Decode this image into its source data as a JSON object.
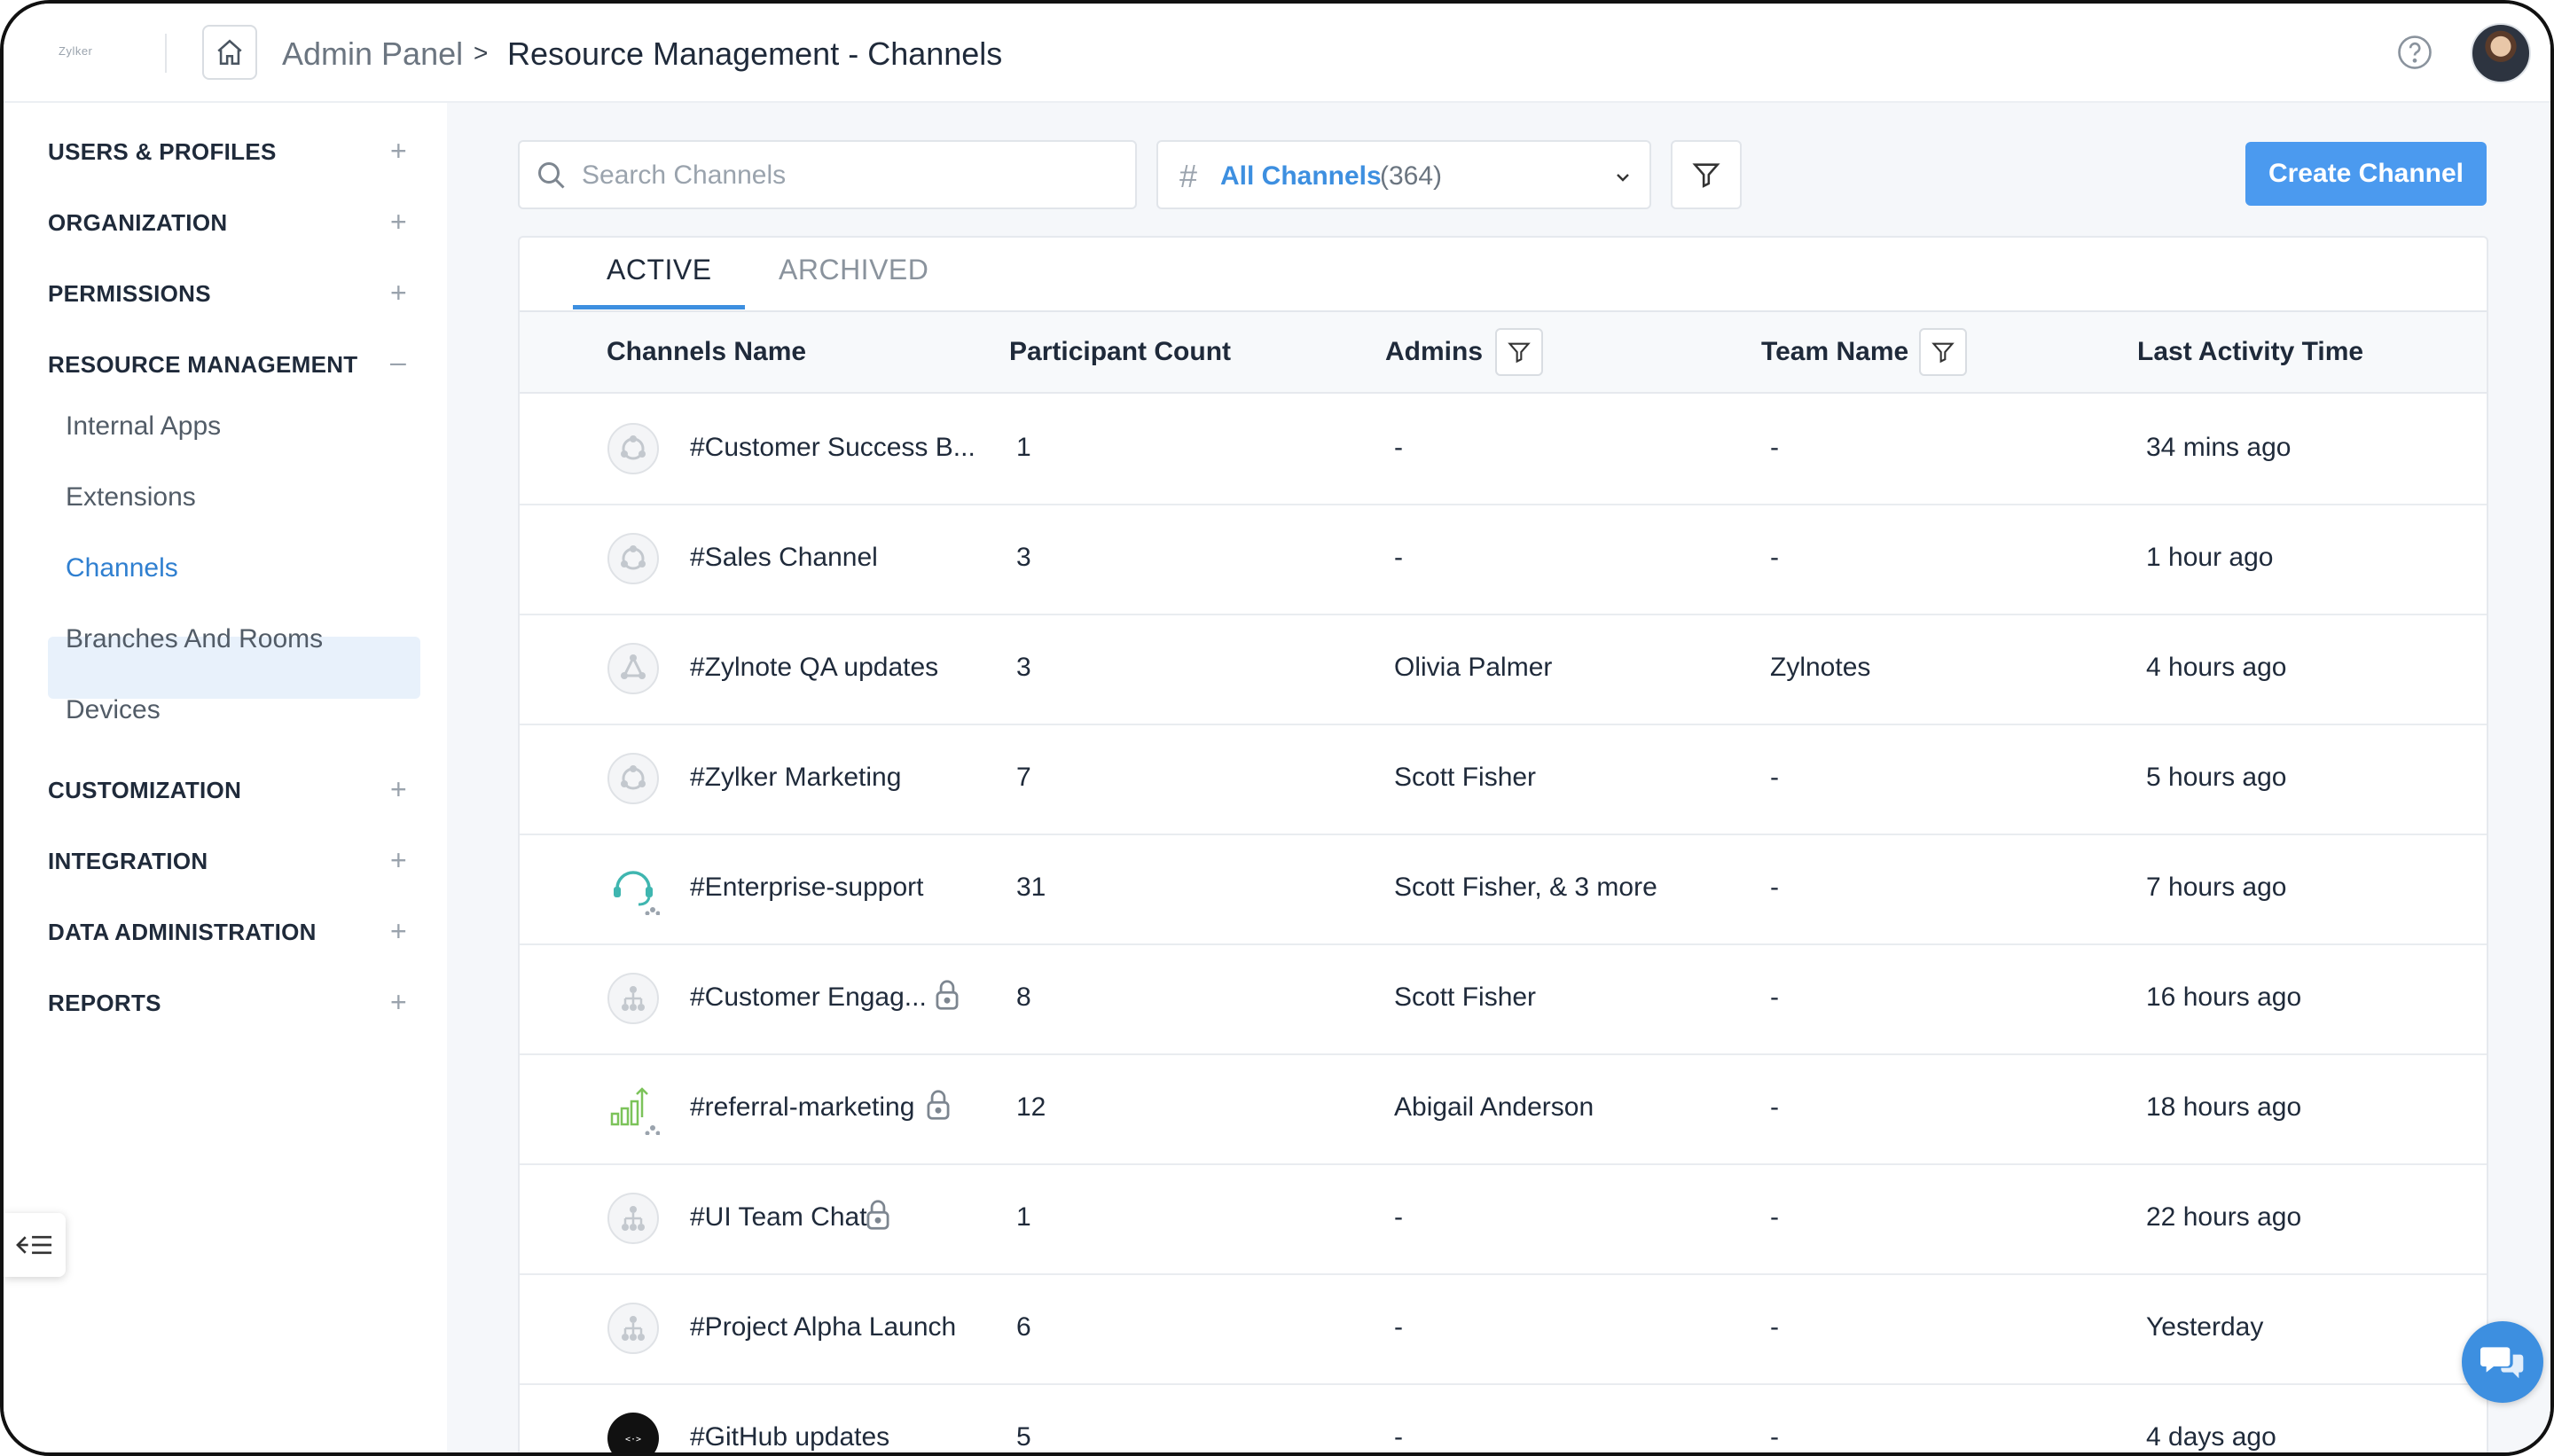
{
  "header": {
    "logo_text": "Zylker",
    "breadcrumb_root": "Admin Panel",
    "breadcrumb_separator": ">",
    "breadcrumb_current": "Resource Management - Channels"
  },
  "sidebar": {
    "sections": [
      {
        "label": "USERS & PROFILES",
        "toggle": "+"
      },
      {
        "label": "ORGANIZATION",
        "toggle": "+"
      },
      {
        "label": "PERMISSIONS",
        "toggle": "+"
      },
      {
        "label": "RESOURCE MANAGEMENT",
        "toggle": "–"
      },
      {
        "label": "CUSTOMIZATION",
        "toggle": "+"
      },
      {
        "label": "INTEGRATION",
        "toggle": "+"
      },
      {
        "label": "DATA ADMINISTRATION",
        "toggle": "+"
      },
      {
        "label": "REPORTS",
        "toggle": "+"
      }
    ],
    "resource_items": [
      "Internal Apps",
      "Extensions",
      "Channels",
      "Branches And Rooms",
      "Devices"
    ],
    "active_item": "Channels"
  },
  "toolbar": {
    "search_placeholder": "Search Channels",
    "select_label": "All Channels",
    "select_count": "(364)",
    "create_label": "Create Channel"
  },
  "tabs": {
    "active": "ACTIVE",
    "archived": "ARCHIVED"
  },
  "table": {
    "headers": [
      "Channels Name",
      "Participant Count",
      "Admins",
      "Team Name",
      "Last Activity Time"
    ],
    "rows": [
      {
        "name": "#Customer Success B...",
        "count": "1",
        "admins": "-",
        "team": "-",
        "last": "34 mins ago",
        "icon": "org-icon",
        "locked": false
      },
      {
        "name": "#Sales Channel",
        "count": "3",
        "admins": "-",
        "team": "-",
        "last": "1 hour ago",
        "icon": "org-icon",
        "locked": false
      },
      {
        "name": "#Zylnote QA updates",
        "count": "3",
        "admins": "Olivia Palmer",
        "team": "Zylnotes",
        "last": "4 hours ago",
        "icon": "team-icon",
        "locked": false
      },
      {
        "name": "#Zylker Marketing",
        "count": "7",
        "admins": "Scott Fisher",
        "team": "-",
        "last": "5 hours ago",
        "icon": "org-icon",
        "locked": false
      },
      {
        "name": "#Enterprise-support",
        "count": "31",
        "admins": "Scott Fisher, & 3 more",
        "team": "-",
        "last": "7 hours ago",
        "icon": "headset-icon",
        "locked": false
      },
      {
        "name": "#Customer Engag...",
        "count": "8",
        "admins": "Scott Fisher",
        "team": "-",
        "last": "16 hours ago",
        "icon": "hierarchy-icon",
        "locked": true
      },
      {
        "name": "#referral-marketing",
        "count": "12",
        "admins": "Abigail Anderson",
        "team": "-",
        "last": "18 hours ago",
        "icon": "growth-chart-icon",
        "locked": true
      },
      {
        "name": "#UI Team Chat",
        "count": "1",
        "admins": "-",
        "team": "-",
        "last": "22 hours ago",
        "icon": "hierarchy-icon",
        "locked": true
      },
      {
        "name": "#Project Alpha Launch",
        "count": "6",
        "admins": "-",
        "team": "-",
        "last": "Yesterday",
        "icon": "hierarchy-icon",
        "locked": false
      },
      {
        "name": "#GitHub updates",
        "count": "5",
        "admins": "-",
        "team": "-",
        "last": "4 days ago",
        "icon": "github-icon",
        "locked": false
      }
    ]
  },
  "colors": {
    "accent": "#3d8fe0",
    "button": "#4b9aef",
    "active_bg": "#e8f1fb",
    "main_bg": "#f5f7fa"
  }
}
